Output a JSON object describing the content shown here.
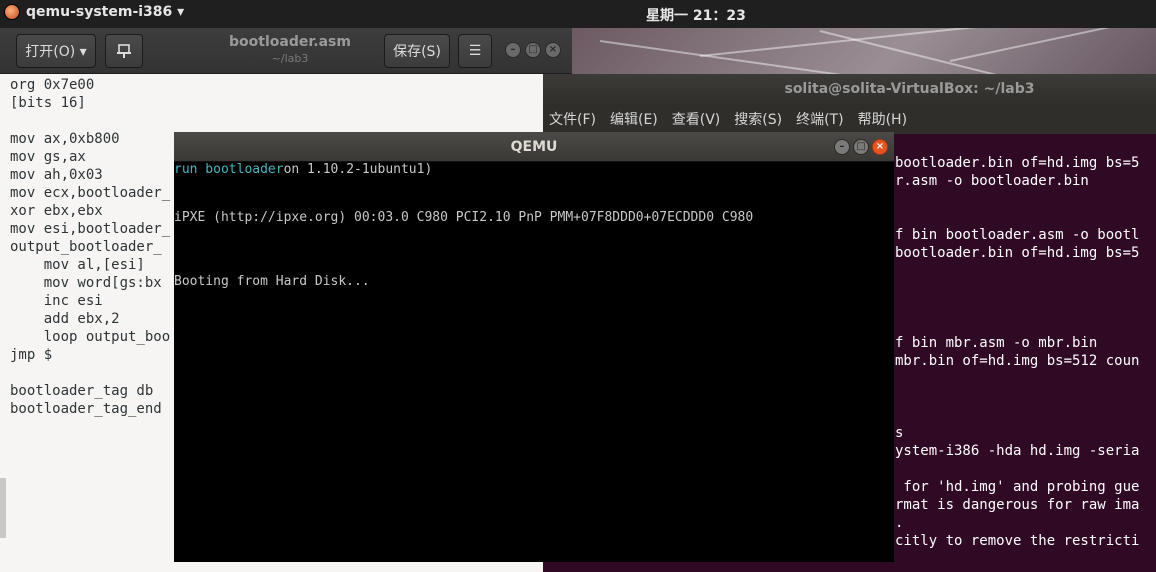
{
  "top_panel": {
    "app_name": "qemu-system-i386 ▾",
    "clock": "星期一 21：23"
  },
  "gedit": {
    "open_label": "打开(O) ▾",
    "pin_icon": "pin-icon",
    "title": "bootloader.asm",
    "path": "~/lab3",
    "save_label": "保存(S)",
    "menu_icon": "☰",
    "code_lines": [
      "org 0x7e00",
      "[bits 16]",
      "",
      "mov ax,0xb800",
      "mov gs,ax",
      "mov ah,0x03",
      "mov ecx,bootloader_",
      "xor ebx,ebx",
      "mov esi,bootloader_",
      "output_bootloader_",
      "    mov al,[esi]",
      "    mov word[gs:bx",
      "    inc esi",
      "    add ebx,2",
      "    loop output_boo",
      "jmp $",
      "",
      "bootloader_tag db",
      "bootloader_tag_end"
    ]
  },
  "terminal": {
    "title": "solita@solita-VirtualBox: ~/lab3",
    "menu": [
      "文件(F)",
      "编辑(E)",
      "查看(V)",
      "搜索(S)",
      "终端(T)",
      "帮助(H)"
    ],
    "lines": [
      "bootloader.bin of=hd.img bs=5",
      "r.asm -o bootloader.bin",
      "",
      "",
      "f bin bootloader.asm -o bootl",
      "bootloader.bin of=hd.img bs=5",
      "",
      "",
      "",
      "",
      "f bin mbr.asm -o mbr.bin",
      "mbr.bin of=hd.img bs=512 coun",
      "",
      "",
      "",
      "s",
      "ystem-i386 -hda hd.img -seria",
      "",
      " for 'hd.img' and probing gue",
      "rmat is dangerous for raw ima",
      ".",
      "citly to remove the restricti"
    ]
  },
  "qemu": {
    "title": "QEMU",
    "line1_run": "run bootloader",
    "line1_rest": "on 1.10.2-1ubuntu1)",
    "line2": "iPXE (http://ipxe.org) 00:03.0 C980 PCI2.10 PnP PMM+07F8DDD0+07ECDDD0 C980",
    "line3": "Booting from Hard Disk..."
  }
}
